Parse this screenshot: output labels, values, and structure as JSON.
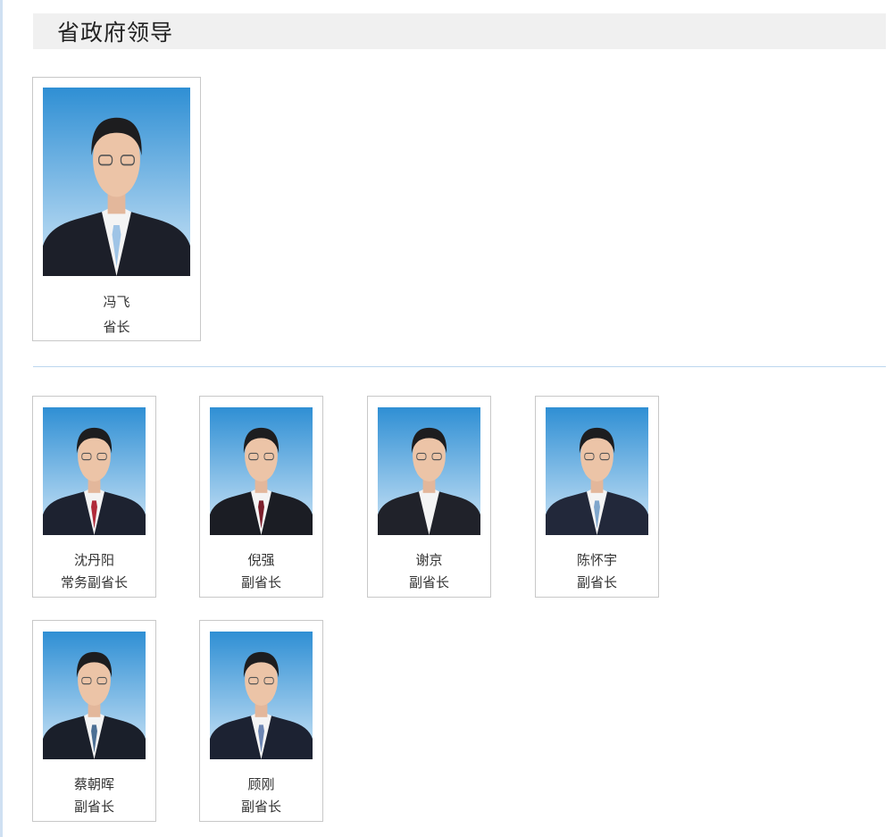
{
  "section": {
    "title": "省政府领导"
  },
  "governor": {
    "name": "冯飞",
    "title": "省长",
    "tie": "#9fc4e6",
    "suit": "#1c1f29"
  },
  "deputies": [
    {
      "name": "沈丹阳",
      "title": "常务副省长",
      "tie": "#b02a3a",
      "suit": "#1d2230"
    },
    {
      "name": "倪强",
      "title": "副省长",
      "tie": "#7c1f2c",
      "suit": "#1b1d24"
    },
    {
      "name": "谢京",
      "title": "副省长",
      "tie": "",
      "suit": "#20222a"
    },
    {
      "name": "陈怀宇",
      "title": "副省长",
      "tie": "#7fa6cc",
      "suit": "#22283a"
    },
    {
      "name": "蔡朝晖",
      "title": "副省长",
      "tie": "#4c6f94",
      "suit": "#1a1f2a"
    },
    {
      "name": "顾刚",
      "title": "副省长",
      "tie": "#6d86b3",
      "suit": "#1c2232"
    }
  ],
  "colors": {
    "photo_bg_top": "#2f8fd4",
    "photo_bg_bottom": "#cfe6f7",
    "header_bg": "#f0f0f0"
  }
}
